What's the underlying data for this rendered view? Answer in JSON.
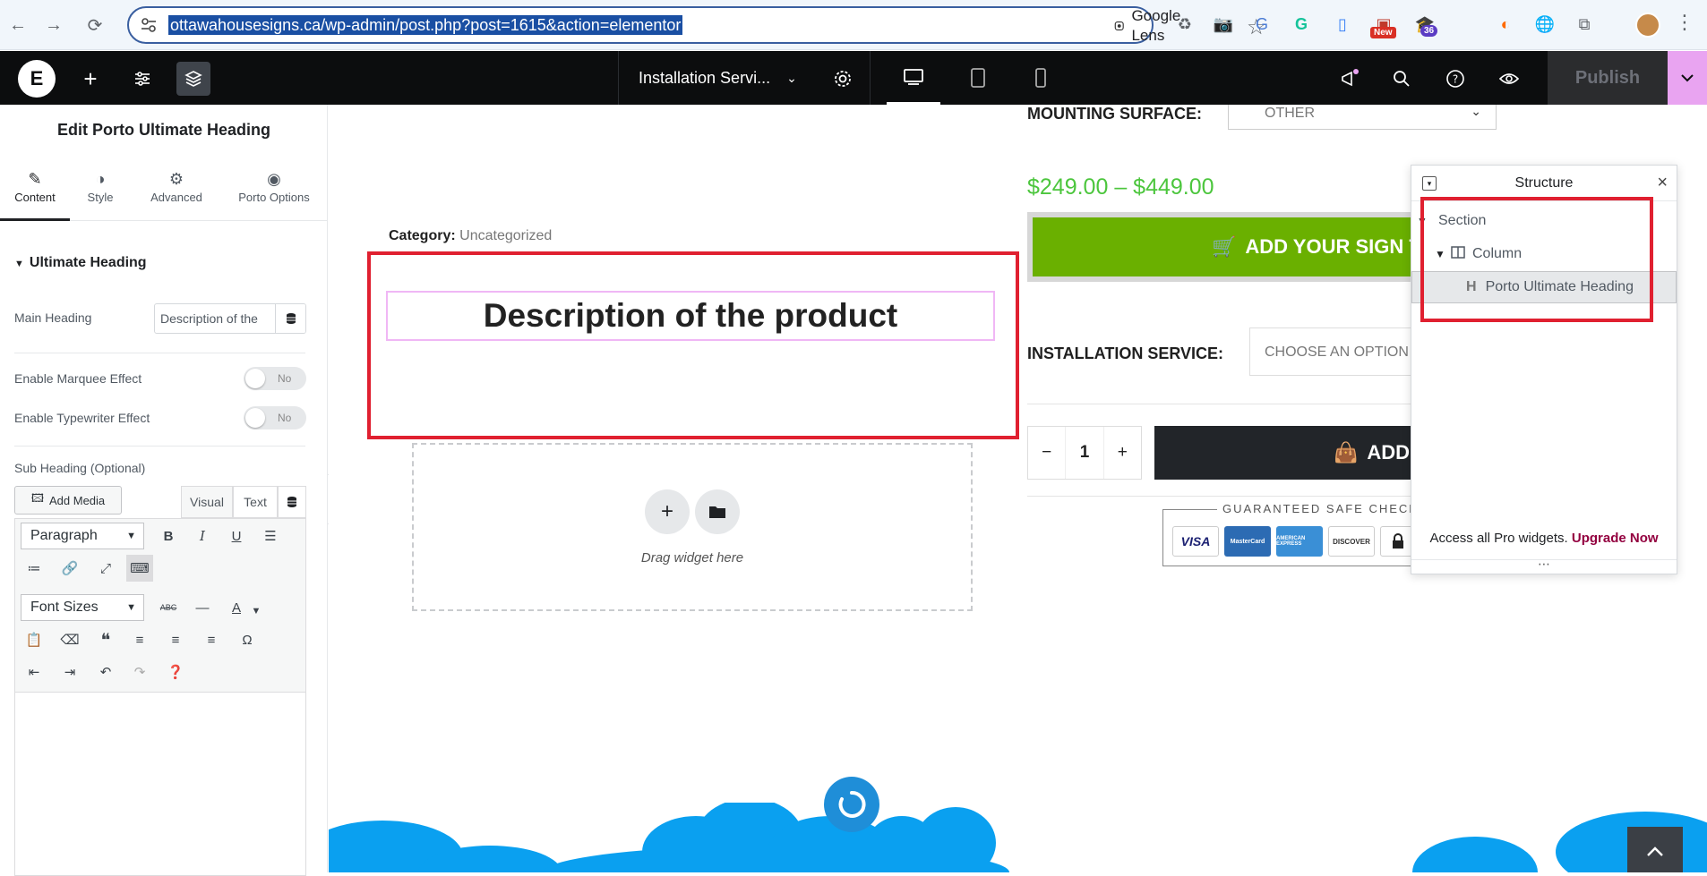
{
  "browser": {
    "url": "ottawahousesigns.ca/wp-admin/post.php?post=1615&action=elementor",
    "lens_label": "Google Lens",
    "badge_new": "New",
    "badge_count": "36"
  },
  "topbar": {
    "document_title": "Installation Servi...",
    "publish_label": "Publish"
  },
  "panel": {
    "title": "Edit Porto Ultimate Heading",
    "tabs": [
      {
        "label": "Content",
        "icon": "pencil-icon",
        "active": true
      },
      {
        "label": "Style",
        "icon": "half-circle-icon"
      },
      {
        "label": "Advanced",
        "icon": "gear-icon"
      },
      {
        "label": "Porto Options",
        "icon": "ring-icon"
      }
    ],
    "section_title": "Ultimate Heading",
    "main_heading_label": "Main Heading",
    "main_heading_value": "Description of the",
    "marquee_label": "Enable Marquee Effect",
    "typewriter_label": "Enable Typewriter Effect",
    "toggle_off": "No",
    "subheading_label": "Sub Heading (Optional)",
    "add_media": "Add Media",
    "visual_tab": "Visual",
    "text_tab": "Text",
    "paragraph_select": "Paragraph",
    "fontsize_select": "Font Sizes"
  },
  "canvas": {
    "category_label": "Category:",
    "category_value": "Uncategorized",
    "heading": "Description of the product",
    "drop_hint": "Drag widget here",
    "mounting_label": "MOUNTING SURFACE:",
    "mounting_value": "OTHER",
    "price": "$249.00 – $449.00",
    "add_sign_btn": "ADD YOUR SIGN TO",
    "installation_label": "INSTALLATION SERVICE:",
    "installation_value": "CHOOSE AN OPTION",
    "qty_minus": "−",
    "qty_value": "1",
    "qty_plus": "+",
    "add_to_btn": "ADD TO",
    "safe_checkout": "GUARANTEED SAFE CHECKO",
    "cards": [
      "VISA",
      "MasterCard",
      "AMERICAN EXPRESS",
      "DISCOVER"
    ],
    "colors": {
      "accent_green": "#6ab000",
      "price_green": "#4cc63d",
      "sky_blue": "#0aa0f0"
    }
  },
  "structure": {
    "title": "Structure",
    "items": [
      {
        "label": "Section",
        "level": 0
      },
      {
        "label": "Column",
        "level": 1
      },
      {
        "label": "Porto Ultimate Heading",
        "level": 2,
        "selected": true
      }
    ],
    "footer_text": "Access all Pro widgets.",
    "footer_link": "Upgrade Now"
  }
}
